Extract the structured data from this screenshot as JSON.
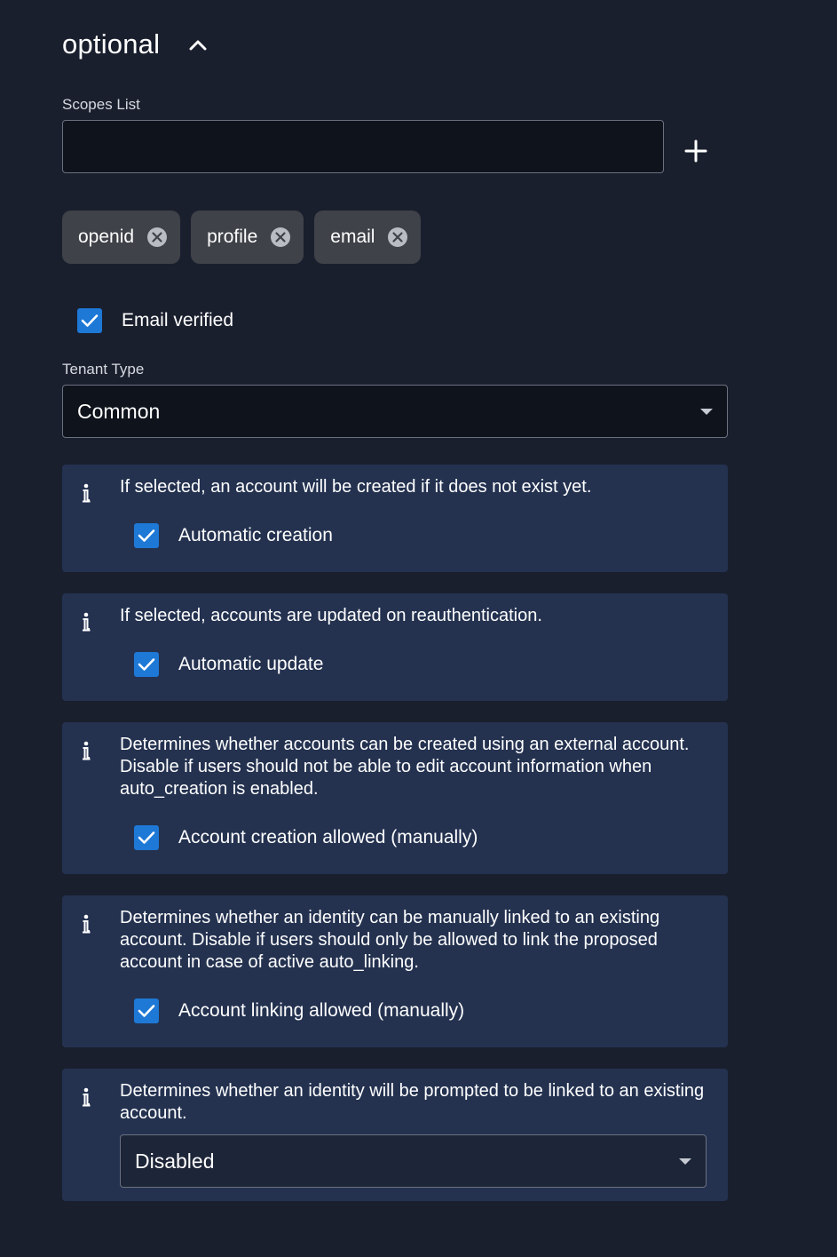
{
  "section": {
    "title": "optional",
    "collapse_icon": "chevron-up-icon"
  },
  "scopes": {
    "label": "Scopes List",
    "input_value": "",
    "add_icon": "plus-icon",
    "chips": [
      {
        "label": "openid"
      },
      {
        "label": "profile"
      },
      {
        "label": "email"
      }
    ]
  },
  "email_verified": {
    "label": "Email verified",
    "checked": true
  },
  "tenant_type": {
    "label": "Tenant Type",
    "value": "Common"
  },
  "cards": [
    {
      "info": "If selected, an account will be created if it does not exist yet.",
      "checkbox_label": "Automatic creation",
      "checked": true
    },
    {
      "info": "If selected, accounts are updated on reauthentication.",
      "checkbox_label": "Automatic update",
      "checked": true
    },
    {
      "info": "Determines whether accounts can be created using an external account. Disable if users should not be able to edit account information when auto_creation is enabled.",
      "checkbox_label": "Account creation allowed (manually)",
      "checked": true
    },
    {
      "info": "Determines whether an identity can be manually linked to an existing account. Disable if users should only be allowed to link the proposed account in case of active auto_linking.",
      "checkbox_label": "Account linking allowed (manually)",
      "checked": true
    },
    {
      "info": "Determines whether an identity will be prompted to be linked to an existing account.",
      "select_value": "Disabled"
    }
  ],
  "colors": {
    "background": "#1a1f2e",
    "card": "#243250",
    "accent": "#1e78d6",
    "chip": "#3f4248"
  }
}
